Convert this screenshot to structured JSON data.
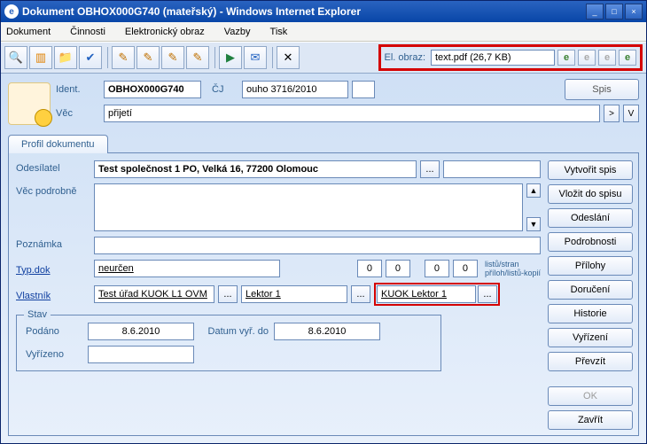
{
  "window": {
    "title": "Dokument OBHOX000G740 (mateřský) - Windows Internet Explorer"
  },
  "menu": {
    "dokument": "Dokument",
    "cinnosti": "Činnosti",
    "elektronicky": "Elektronický obraz",
    "vazby": "Vazby",
    "tisk": "Tisk"
  },
  "elobraz": {
    "label": "El. obraz:",
    "value": "text.pdf (26,7 KB)"
  },
  "header": {
    "ident_label": "Ident.",
    "ident": "OBHOX000G740",
    "cj_label": "ČJ",
    "cj": "ouho 3716/2010",
    "vec_label": "Věc",
    "vec": "přijetí",
    "spis_btn": "Spis",
    "gt": ">",
    "vbtn": "V"
  },
  "tab": {
    "profil": "Profil dokumentu"
  },
  "form": {
    "odesilatel_label": "Odesílatel",
    "odesilatel": "Test společnost 1 PO, Velká 16, 77200 Olomouc",
    "vec_podrobne_label": "Věc podrobně",
    "vec_podrobne": "",
    "poznamka_label": "Poznámka",
    "poznamka": "",
    "typdok_label": "Typ.dok",
    "typdok": "neurčen",
    "zero": "0",
    "listinfo_l1": "listů/stran",
    "listinfo_l2": "příloh/listů-kopií",
    "vlastnik_label": "Vlastník",
    "vlastnik_urad": "Test úřad KUOK L1 OVM",
    "lektor": "Lektor 1",
    "kuok": "KUOK Lektor 1",
    "dots": "..."
  },
  "stav": {
    "legend": "Stav",
    "podano_label": "Podáno",
    "podano": "8.6.2010",
    "datvyr_label": "Datum vyř. do",
    "datvyr": "8.6.2010",
    "vyrizeno_label": "Vyřízeno",
    "vyrizeno": ""
  },
  "sidebar": {
    "vytvorit": "Vytvořit spis",
    "vlozit": "Vložit do spisu",
    "odeslani": "Odeslání",
    "podrobnosti": "Podrobnosti",
    "prilohy": "Přílohy",
    "doruceni": "Doručení",
    "historie": "Historie",
    "vyrizeni": "Vyřízení",
    "prevzit": "Převzít",
    "ok": "OK",
    "zavrit": "Zavřít"
  },
  "icons": {
    "min": "_",
    "max": "□",
    "close": "×",
    "up": "▲",
    "down": "▼"
  }
}
